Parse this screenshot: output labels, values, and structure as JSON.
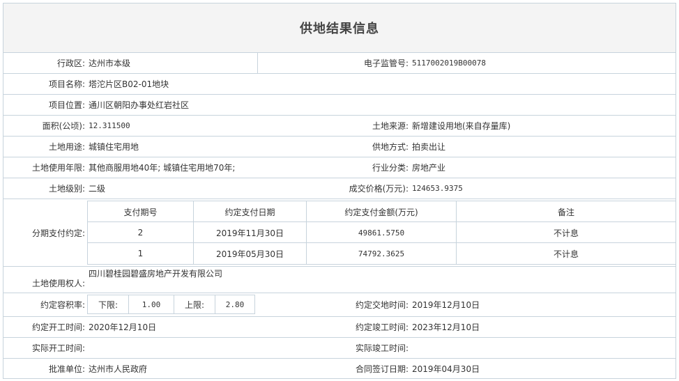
{
  "title": "供地结果信息",
  "fields": {
    "district_label": "行政区:",
    "district": "达州市本级",
    "supervision_no_label": "电子监管号:",
    "supervision_no": "5117002019B00078",
    "project_name_label": "项目名称:",
    "project_name": "塔沱片区B02-01地块",
    "project_location_label": "项目位置:",
    "project_location": "通川区朝阳办事处红岩社区",
    "area_label": "面积(公顷):",
    "area": "12.311500",
    "land_source_label": "土地来源:",
    "land_source": "新增建设用地(来自存量库)",
    "land_use_label": "土地用途:",
    "land_use": "城镇住宅用地",
    "supply_method_label": "供地方式:",
    "supply_method": "拍卖出让",
    "use_term_label": "土地使用年限:",
    "use_term": "其他商服用地40年; 城镇住宅用地70年;",
    "industry_label": "行业分类:",
    "industry": "房地产业",
    "land_grade_label": "土地级别:",
    "land_grade": "二级",
    "price_label": "成交价格(万元):",
    "price": "124653.9375",
    "installment_label": "分期支付约定:",
    "land_user_label": "土地使用权人:",
    "land_user": "四川碧桂园碧盛房地产开发有限公司",
    "far_label": "约定容积率:",
    "far_lower_label": "下限:",
    "far_lower": "1.00",
    "far_upper_label": "上限:",
    "far_upper": "2.80",
    "delivery_time_label": "约定交地时间:",
    "delivery_time": "2019年12月10日",
    "start_time_label": "约定开工时间:",
    "start_time": "2020年12月10日",
    "completion_time_label": "约定竣工时间:",
    "completion_time": "2023年12月10日",
    "actual_start_label": "实际开工时间:",
    "actual_start": "",
    "actual_completion_label": "实际竣工时间:",
    "actual_completion": "",
    "approval_unit_label": "批准单位:",
    "approval_unit": "达州市人民政府",
    "contract_date_label": "合同签订日期:",
    "contract_date": "2019年04月30日"
  },
  "installments": {
    "headers": [
      "支付期号",
      "约定支付日期",
      "约定支付金额(万元)",
      "备注"
    ],
    "rows": [
      [
        "2",
        "2019年11月30日",
        "49861.5750",
        "不计息"
      ],
      [
        "1",
        "2019年05月30日",
        "74792.3625",
        "不计息"
      ]
    ]
  }
}
